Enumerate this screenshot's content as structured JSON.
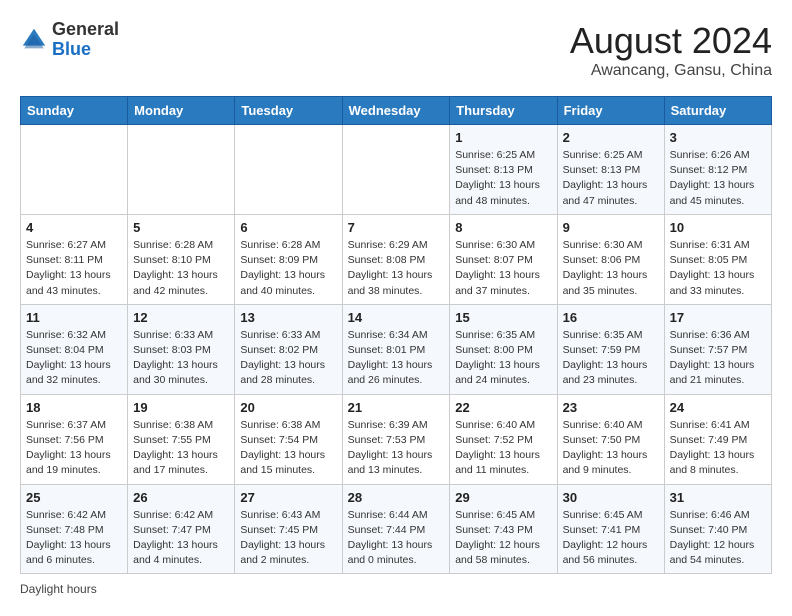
{
  "header": {
    "logo_general": "General",
    "logo_blue": "Blue",
    "month_year": "August 2024",
    "location": "Awancang, Gansu, China"
  },
  "weekdays": [
    "Sunday",
    "Monday",
    "Tuesday",
    "Wednesday",
    "Thursday",
    "Friday",
    "Saturday"
  ],
  "footer": {
    "daylight_hours": "Daylight hours"
  },
  "weeks": [
    [
      {
        "day": "",
        "info": ""
      },
      {
        "day": "",
        "info": ""
      },
      {
        "day": "",
        "info": ""
      },
      {
        "day": "",
        "info": ""
      },
      {
        "day": "1",
        "info": "Sunrise: 6:25 AM\nSunset: 8:13 PM\nDaylight: 13 hours\nand 48 minutes."
      },
      {
        "day": "2",
        "info": "Sunrise: 6:25 AM\nSunset: 8:13 PM\nDaylight: 13 hours\nand 47 minutes."
      },
      {
        "day": "3",
        "info": "Sunrise: 6:26 AM\nSunset: 8:12 PM\nDaylight: 13 hours\nand 45 minutes."
      }
    ],
    [
      {
        "day": "4",
        "info": "Sunrise: 6:27 AM\nSunset: 8:11 PM\nDaylight: 13 hours\nand 43 minutes."
      },
      {
        "day": "5",
        "info": "Sunrise: 6:28 AM\nSunset: 8:10 PM\nDaylight: 13 hours\nand 42 minutes."
      },
      {
        "day": "6",
        "info": "Sunrise: 6:28 AM\nSunset: 8:09 PM\nDaylight: 13 hours\nand 40 minutes."
      },
      {
        "day": "7",
        "info": "Sunrise: 6:29 AM\nSunset: 8:08 PM\nDaylight: 13 hours\nand 38 minutes."
      },
      {
        "day": "8",
        "info": "Sunrise: 6:30 AM\nSunset: 8:07 PM\nDaylight: 13 hours\nand 37 minutes."
      },
      {
        "day": "9",
        "info": "Sunrise: 6:30 AM\nSunset: 8:06 PM\nDaylight: 13 hours\nand 35 minutes."
      },
      {
        "day": "10",
        "info": "Sunrise: 6:31 AM\nSunset: 8:05 PM\nDaylight: 13 hours\nand 33 minutes."
      }
    ],
    [
      {
        "day": "11",
        "info": "Sunrise: 6:32 AM\nSunset: 8:04 PM\nDaylight: 13 hours\nand 32 minutes."
      },
      {
        "day": "12",
        "info": "Sunrise: 6:33 AM\nSunset: 8:03 PM\nDaylight: 13 hours\nand 30 minutes."
      },
      {
        "day": "13",
        "info": "Sunrise: 6:33 AM\nSunset: 8:02 PM\nDaylight: 13 hours\nand 28 minutes."
      },
      {
        "day": "14",
        "info": "Sunrise: 6:34 AM\nSunset: 8:01 PM\nDaylight: 13 hours\nand 26 minutes."
      },
      {
        "day": "15",
        "info": "Sunrise: 6:35 AM\nSunset: 8:00 PM\nDaylight: 13 hours\nand 24 minutes."
      },
      {
        "day": "16",
        "info": "Sunrise: 6:35 AM\nSunset: 7:59 PM\nDaylight: 13 hours\nand 23 minutes."
      },
      {
        "day": "17",
        "info": "Sunrise: 6:36 AM\nSunset: 7:57 PM\nDaylight: 13 hours\nand 21 minutes."
      }
    ],
    [
      {
        "day": "18",
        "info": "Sunrise: 6:37 AM\nSunset: 7:56 PM\nDaylight: 13 hours\nand 19 minutes."
      },
      {
        "day": "19",
        "info": "Sunrise: 6:38 AM\nSunset: 7:55 PM\nDaylight: 13 hours\nand 17 minutes."
      },
      {
        "day": "20",
        "info": "Sunrise: 6:38 AM\nSunset: 7:54 PM\nDaylight: 13 hours\nand 15 minutes."
      },
      {
        "day": "21",
        "info": "Sunrise: 6:39 AM\nSunset: 7:53 PM\nDaylight: 13 hours\nand 13 minutes."
      },
      {
        "day": "22",
        "info": "Sunrise: 6:40 AM\nSunset: 7:52 PM\nDaylight: 13 hours\nand 11 minutes."
      },
      {
        "day": "23",
        "info": "Sunrise: 6:40 AM\nSunset: 7:50 PM\nDaylight: 13 hours\nand 9 minutes."
      },
      {
        "day": "24",
        "info": "Sunrise: 6:41 AM\nSunset: 7:49 PM\nDaylight: 13 hours\nand 8 minutes."
      }
    ],
    [
      {
        "day": "25",
        "info": "Sunrise: 6:42 AM\nSunset: 7:48 PM\nDaylight: 13 hours\nand 6 minutes."
      },
      {
        "day": "26",
        "info": "Sunrise: 6:42 AM\nSunset: 7:47 PM\nDaylight: 13 hours\nand 4 minutes."
      },
      {
        "day": "27",
        "info": "Sunrise: 6:43 AM\nSunset: 7:45 PM\nDaylight: 13 hours\nand 2 minutes."
      },
      {
        "day": "28",
        "info": "Sunrise: 6:44 AM\nSunset: 7:44 PM\nDaylight: 13 hours\nand 0 minutes."
      },
      {
        "day": "29",
        "info": "Sunrise: 6:45 AM\nSunset: 7:43 PM\nDaylight: 12 hours\nand 58 minutes."
      },
      {
        "day": "30",
        "info": "Sunrise: 6:45 AM\nSunset: 7:41 PM\nDaylight: 12 hours\nand 56 minutes."
      },
      {
        "day": "31",
        "info": "Sunrise: 6:46 AM\nSunset: 7:40 PM\nDaylight: 12 hours\nand 54 minutes."
      }
    ]
  ]
}
